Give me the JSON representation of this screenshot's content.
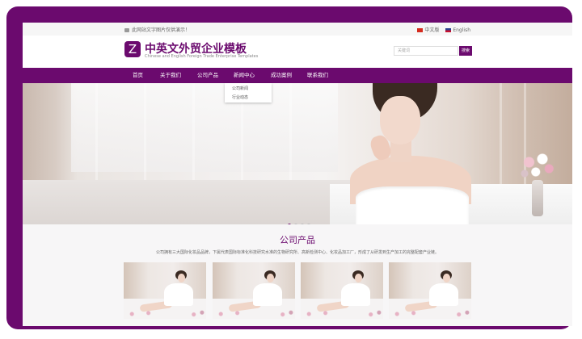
{
  "topbar": {
    "notice": "此网站文字图片仅供演示！",
    "lang_cn": "中文版",
    "lang_en": "English"
  },
  "header": {
    "logo_letter": "Z",
    "title": "中英文外贸企业模板",
    "subtitle": "Chinese and English Foreign Trade Enterprise Templates",
    "search_placeholder": "关键词",
    "search_button": "搜索"
  },
  "nav": {
    "items": [
      {
        "label": "首页"
      },
      {
        "label": "关于我们"
      },
      {
        "label": "公司产品"
      },
      {
        "label": "新闻中心"
      },
      {
        "label": "成功案例"
      },
      {
        "label": "联系我们"
      }
    ],
    "dropdown": [
      "公司新闻",
      "行业动态"
    ]
  },
  "hero": {
    "slides_total": 4,
    "active_slide": 1
  },
  "products": {
    "title": "公司产品",
    "description": "公司拥有三大国际化妆品品牌，下属代表国际标准化科技研究水准的生物研究所、高新检测中心、化妆品加工厂，形成了从研发到生产加工的完整配套产业链。"
  },
  "colors": {
    "brand": "#6b0a6e",
    "background": "#ffffff",
    "section_bg": "#f7f6f7"
  }
}
